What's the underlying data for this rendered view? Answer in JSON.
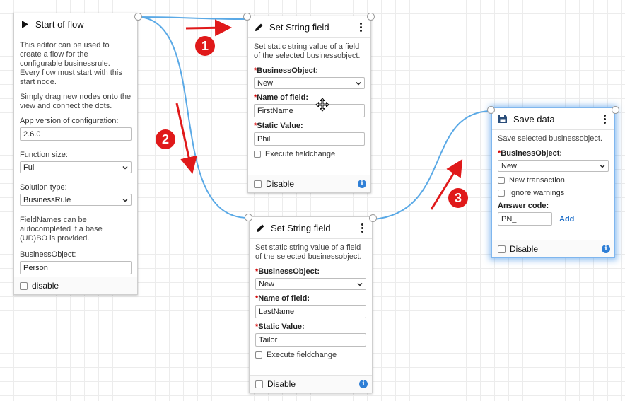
{
  "start_node": {
    "title": "Start of flow",
    "description_1": "This editor can be used to create a flow for the configurable businessrule. Every flow must start with this start node.",
    "description_2": "Simply drag new nodes onto the view and connect the dots.",
    "app_version_label": "App version of configuration:",
    "app_version_value": "2.6.0",
    "function_size_label": "Function size:",
    "function_size_value": "Full",
    "solution_type_label": "Solution type:",
    "solution_type_value": "BusinessRule",
    "fieldnames_note": "FieldNames can be autocompleted if a base (UD)BO is provided.",
    "business_object_label": "BusinessObject:",
    "business_object_value": "Person",
    "disable_label": "disable"
  },
  "set_string_1": {
    "title": "Set String field",
    "description": "Set static string value of a field of the selected businessobject.",
    "bo_label": "BusinessObject:",
    "bo_value": "New",
    "field_label": "Name of field:",
    "field_value": "FirstName",
    "static_label": "Static Value:",
    "static_value": "Phil",
    "execute_label": "Execute fieldchange",
    "disable_label": "Disable",
    "info": "i"
  },
  "set_string_2": {
    "title": "Set String field",
    "description": "Set static string value of a field of the selected businessobject.",
    "bo_label": "BusinessObject:",
    "bo_value": "New",
    "field_label": "Name of field:",
    "field_value": "LastName",
    "static_label": "Static Value:",
    "static_value": "Tailor",
    "execute_label": "Execute fieldchange",
    "disable_label": "Disable",
    "info": "i"
  },
  "save_data": {
    "title": "Save data",
    "description": "Save selected businessobject.",
    "bo_label": "BusinessObject:",
    "bo_value": "New",
    "new_transaction_label": "New transaction",
    "ignore_warnings_label": "Ignore warnings",
    "answer_code_label": "Answer code:",
    "answer_code_value": "PN_",
    "add_label": "Add",
    "disable_label": "Disable",
    "info": "i"
  },
  "required_mark": "*",
  "annotations": {
    "one": "1",
    "two": "2",
    "three": "3"
  },
  "colors": {
    "connector": "#5aa9e6",
    "arrow": "#e0191a",
    "selected_glow": "#4291e6",
    "info": "#2f7fd6"
  }
}
